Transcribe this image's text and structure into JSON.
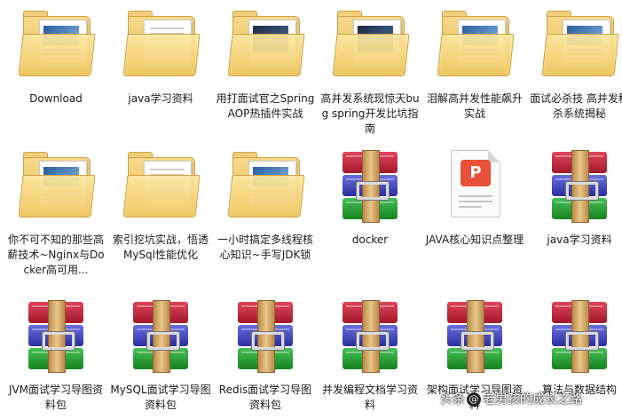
{
  "rows": [
    {
      "items": [
        {
          "label": "Download",
          "icon": "folder-icon",
          "kind": "folder"
        },
        {
          "label": "java学习资料",
          "icon": "folder-icon",
          "kind": "folder"
        },
        {
          "label": "用打面试官之SpringAOP热插件实战",
          "icon": "folder-icon",
          "kind": "folder"
        },
        {
          "label": "高并发系统现惊天bug spring开发比坑指南",
          "icon": "folder-icon",
          "kind": "folder"
        },
        {
          "label": "泪解高并发性能飙升实战",
          "icon": "folder-icon",
          "kind": "folder"
        },
        {
          "label": "面试必杀技 高并发秒杀系统揭秘",
          "icon": "folder-icon",
          "kind": "folder"
        }
      ]
    },
    {
      "items": [
        {
          "label": "你不可不知的那些高薪技术~Nginx与Docker高可用...",
          "icon": "folder-icon",
          "kind": "folder"
        },
        {
          "label": "索引挖坑实战，悟透MySql性能优化",
          "icon": "folder-icon",
          "kind": "folder"
        },
        {
          "label": "一小时搞定多线程核心知识~手写JDK锁",
          "icon": "folder-icon",
          "kind": "folder"
        },
        {
          "label": "docker",
          "icon": "winrar-archive-icon",
          "kind": "archive"
        },
        {
          "label": "JAVA核心知识点整理",
          "icon": "pdf-document-icon",
          "kind": "pdf"
        },
        {
          "label": "java学习资料",
          "icon": "winrar-archive-icon",
          "kind": "archive"
        }
      ]
    },
    {
      "items": [
        {
          "label": "JVM面试学习导图资料包",
          "icon": "winrar-archive-icon",
          "kind": "archive"
        },
        {
          "label": "MySQL面试学习导图资料包",
          "icon": "winrar-archive-icon",
          "kind": "archive"
        },
        {
          "label": "Redis面试学习导图资料包",
          "icon": "winrar-archive-icon",
          "kind": "archive"
        },
        {
          "label": "并发编程文档学习资料",
          "icon": "winrar-archive-icon",
          "kind": "archive"
        },
        {
          "label": "架构面试学习导图资料",
          "icon": "winrar-archive-icon",
          "kind": "archive"
        },
        {
          "label": "算法与数据结构",
          "icon": "winrar-archive-icon",
          "kind": "archive"
        }
      ]
    }
  ],
  "watermark": {
    "prefix": "头条",
    "at": "@",
    "account": "老男孩的成长之路"
  }
}
